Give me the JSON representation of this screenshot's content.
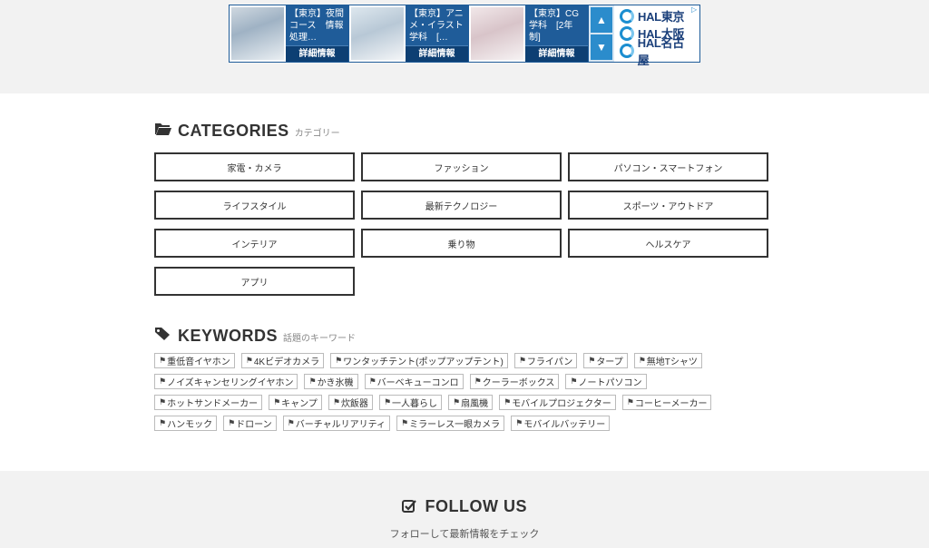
{
  "ad": {
    "cards": [
      {
        "title": "【東京】夜間コース　情報処理…",
        "button": "詳細情報"
      },
      {
        "title": "【東京】アニメ・イラスト学科　[…",
        "button": "詳細情報"
      },
      {
        "title": "【東京】CG学科　[2年制]",
        "button": "詳細情報"
      }
    ],
    "nav_up": "▲",
    "nav_down": "▼",
    "logos": [
      "HAL東京",
      "HAL大阪",
      "HAL名古屋"
    ]
  },
  "categories": {
    "title": "CATEGORIES",
    "subtitle": "カテゴリー",
    "icon": "folder-open-icon",
    "items": [
      "家電・カメラ",
      "ファッション",
      "パソコン・スマートフォン",
      "ライフスタイル",
      "最新テクノロジー",
      "スポーツ・アウトドア",
      "インテリア",
      "乗り物",
      "ヘルスケア",
      "アプリ"
    ]
  },
  "keywords": {
    "title": "KEYWORDS",
    "subtitle": "話題のキーワード",
    "icon": "tag-icon",
    "items": [
      "重低音イヤホン",
      "4Kビデオカメラ",
      "ワンタッチテント(ポップアップテント)",
      "フライパン",
      "タープ",
      "無地Tシャツ",
      "ノイズキャンセリングイヤホン",
      "かき氷機",
      "バーベキューコンロ",
      "クーラーボックス",
      "ノートパソコン",
      "ホットサンドメーカー",
      "キャンプ",
      "炊飯器",
      "一人暮らし",
      "扇風機",
      "モバイルプロジェクター",
      "コーヒーメーカー",
      "ハンモック",
      "ドローン",
      "バーチャルリアリティ",
      "ミラーレス一眼カメラ",
      "モバイルバッテリー"
    ]
  },
  "follow": {
    "title": "FOLLOW US",
    "subtitle": "フォローして最新情報をチェック",
    "icon": "check-square-icon"
  },
  "colors": {
    "ad_blue": "#1f5c99",
    "band_grey": "#f2f2f2",
    "text": "#333333"
  }
}
